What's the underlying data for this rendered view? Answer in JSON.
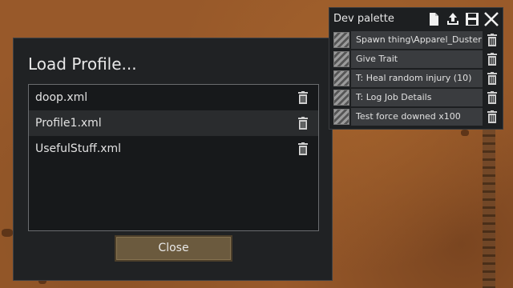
{
  "load_profile": {
    "title": "Load Profile...",
    "files": [
      {
        "name": "doop.xml"
      },
      {
        "name": "Profile1.xml"
      },
      {
        "name": "UsefulStuff.xml"
      }
    ],
    "close_label": "Close"
  },
  "dev_palette": {
    "title": "Dev palette",
    "toolbar_icons": [
      "new-file-icon",
      "upload-icon",
      "save-icon",
      "close-icon"
    ],
    "items": [
      {
        "label": "Spawn thing\\Apparel_Duster"
      },
      {
        "label": "Give Trait"
      },
      {
        "label": "T: Heal random injury (10)"
      },
      {
        "label": "T: Log Job Details"
      },
      {
        "label": "Test force downed x100"
      }
    ]
  }
}
